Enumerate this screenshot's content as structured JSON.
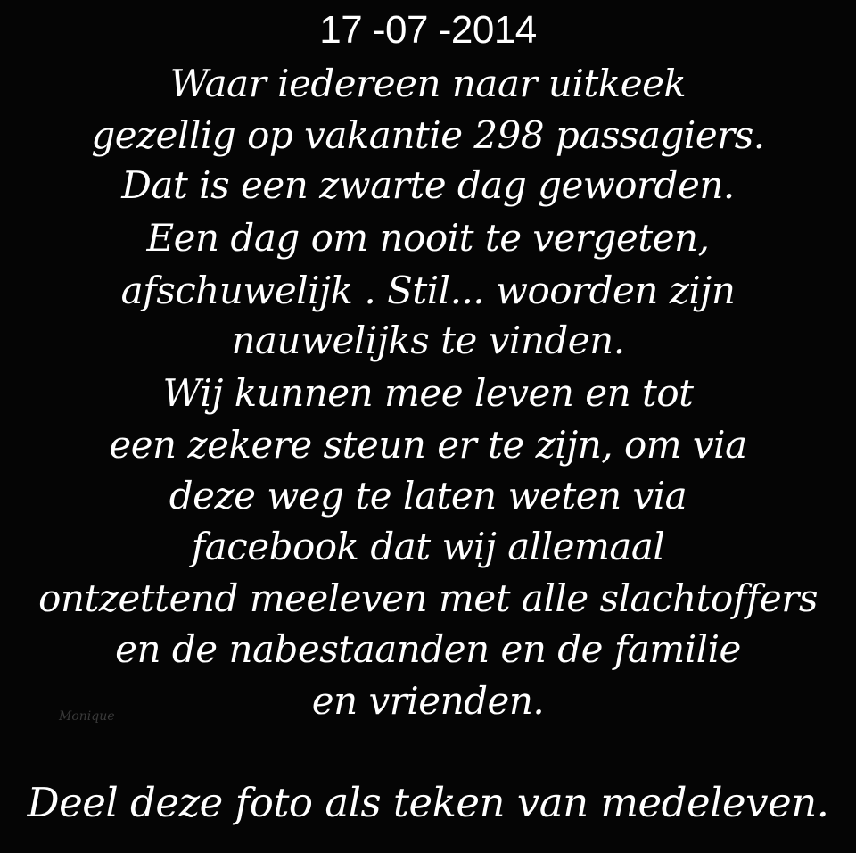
{
  "poem": {
    "date": "17 -07 -2014",
    "lines": [
      "Waar iedereen naar uitkeek",
      "gezellig op vakantie 298 passagiers.",
      "Dat is een zwarte dag geworden.",
      "Een dag om nooit te vergeten,",
      "afschuwelijk . Stil... woorden zijn",
      "nauwelijks te vinden.",
      "Wij kunnen mee leven en tot",
      "een zekere steun er te zijn, om via",
      "deze weg te laten weten via",
      "facebook dat wij allemaal",
      "ontzettend meeleven met alle slachtoffers",
      "en de nabestaanden en de familie",
      "en vrienden."
    ],
    "closing": "Deel deze foto als teken van medeleven."
  },
  "watermark": "Monique",
  "colors": {
    "background": "#050505",
    "text": "#ffffff"
  }
}
